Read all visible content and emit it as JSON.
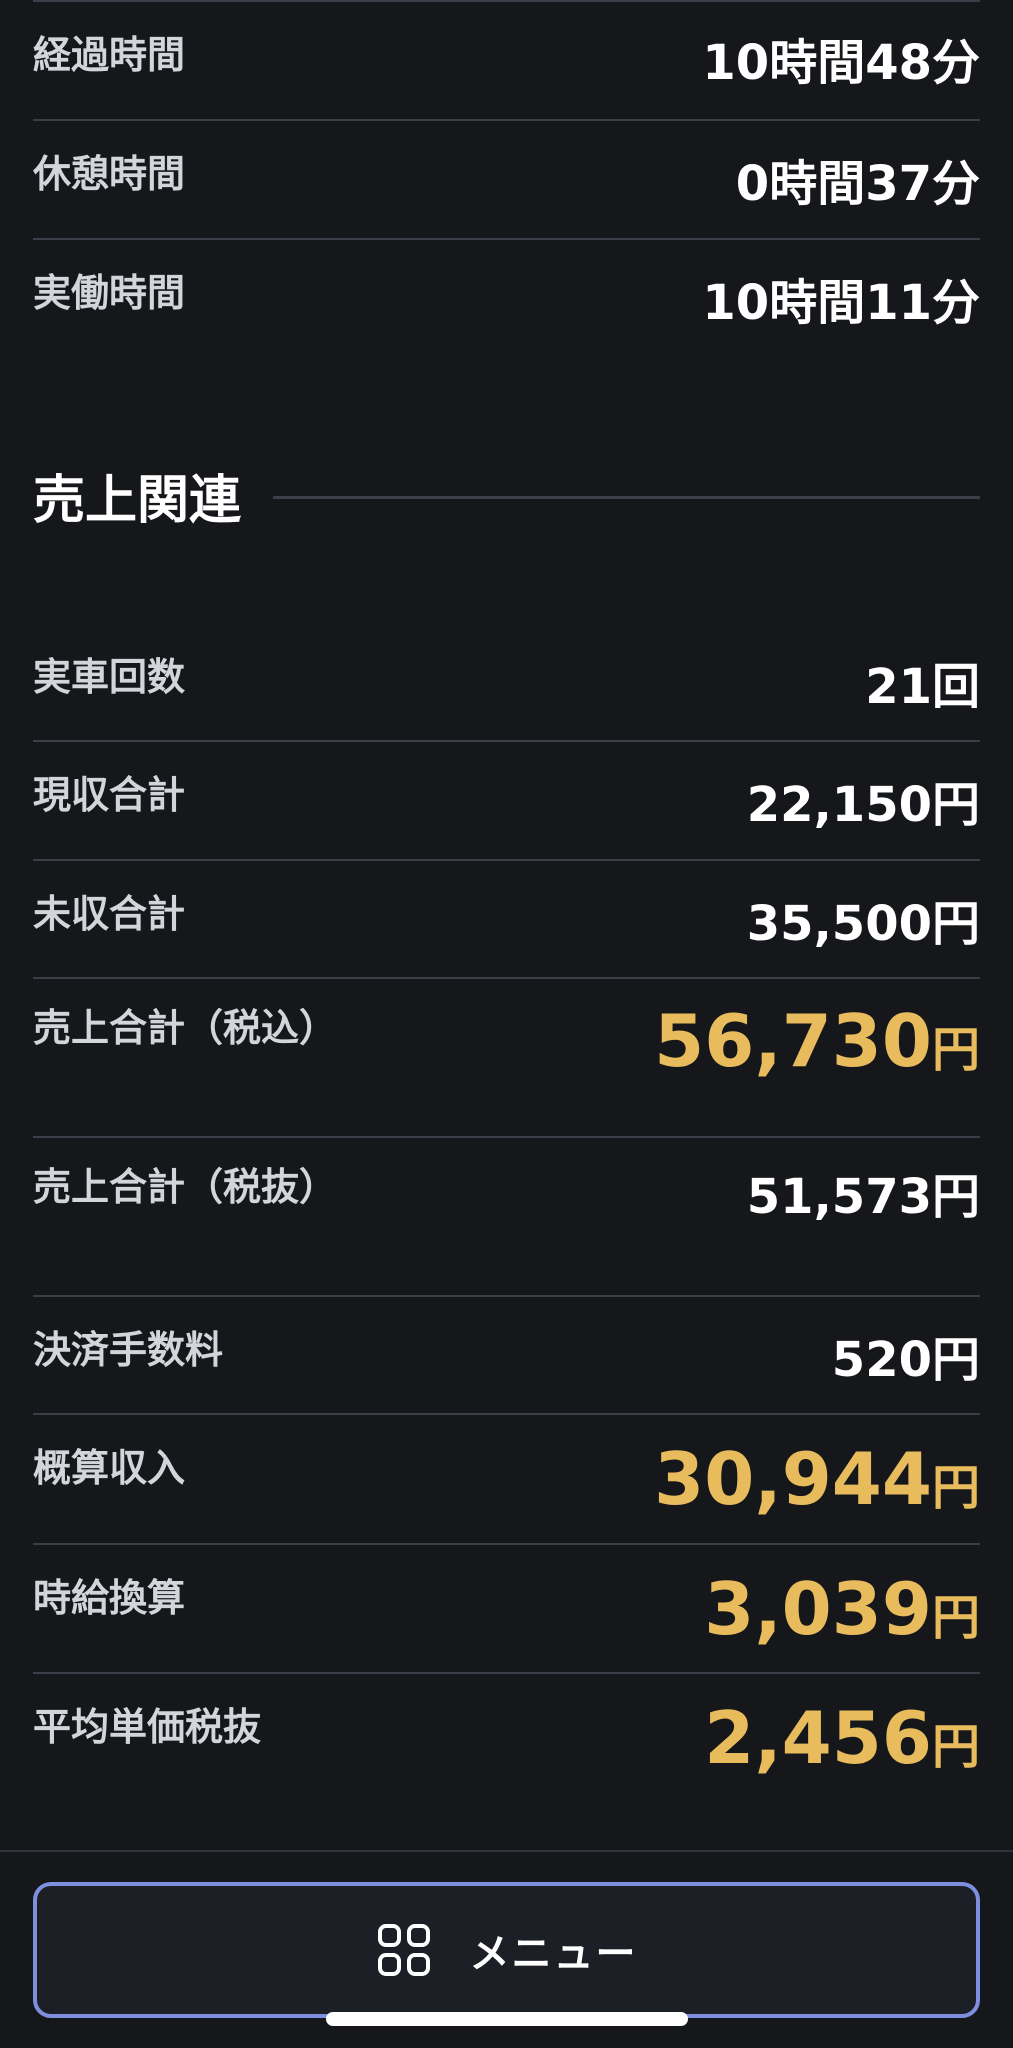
{
  "time_rows": [
    {
      "label": "経過時間",
      "value": "10時間48分"
    },
    {
      "label": "休憩時間",
      "value": "0時間37分"
    },
    {
      "label": "実働時間",
      "value": "10時間11分"
    }
  ],
  "sales_section": {
    "title": "売上関連"
  },
  "sales_rows": [
    {
      "label": "実車回数",
      "value": "21回"
    },
    {
      "label": "現収合計",
      "value": "22,150円"
    },
    {
      "label": "未収合計",
      "value": "35,500円"
    },
    {
      "label": "売上合計（税込）",
      "number": "56,730",
      "unit": "円"
    },
    {
      "label": "売上合計（税抜）",
      "value": "51,573円"
    },
    {
      "label": "決済手数料",
      "value": "520円"
    },
    {
      "label": "概算収入",
      "number": "30,944",
      "unit": "円"
    },
    {
      "label": "時給換算",
      "number": "3,039",
      "unit": "円"
    },
    {
      "label": "平均単価税抜",
      "number": "2,456",
      "unit": "円"
    }
  ],
  "bottom": {
    "menu_label": "メニュー"
  },
  "colors": {
    "background": "#15171b",
    "highlight": "#e8bc5c",
    "divider": "#3a3e47",
    "button_border": "#7f8fe0"
  },
  "icons": {
    "menu": "grid-icon"
  }
}
